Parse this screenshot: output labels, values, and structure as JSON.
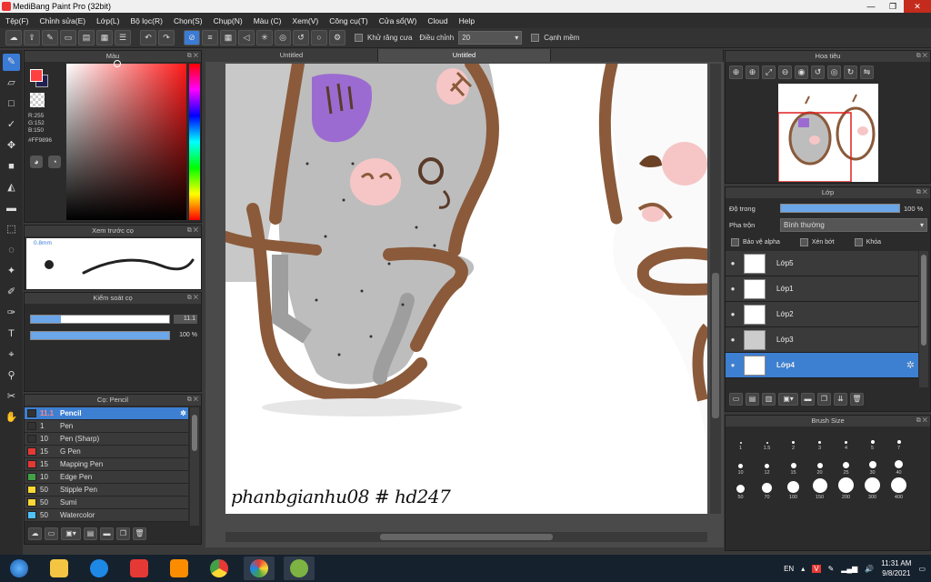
{
  "window": {
    "title": "MediBang Paint Pro (32bit)"
  },
  "menu": [
    "Tệp(F)",
    "Chỉnh sửa(E)",
    "Lớp(L)",
    "Bộ lọc(R)",
    "Chọn(S)",
    "Chụp(N)",
    "Màu (C)",
    "Xem(V)",
    "Công cụ(T)",
    "Cửa sổ(W)",
    "Cloud",
    "Help"
  ],
  "toolbar": {
    "antialias_label": "Khử răng cưa",
    "adjust_label": "Điều chỉnh",
    "adjust_value": "20",
    "edge_label": "Cạnh mềm"
  },
  "tabs": [
    "Untitled",
    "Untitled"
  ],
  "color_panel": {
    "title": "Màu",
    "r": "R:255",
    "g": "G:152",
    "b": "B:150",
    "hex": "#FF9896",
    "primary": "#ff4040",
    "secondary": "#202050"
  },
  "brush_preview": {
    "title": "Xem trước cọ",
    "size": "0.8mm"
  },
  "brush_control": {
    "title": "Kiểm soát cọ",
    "size_value": "11.1",
    "opacity_value": "100 %",
    "size_fraction": 0.22,
    "opacity_fraction": 1.0
  },
  "brush_list": {
    "title": "Cọ: Pencil",
    "items": [
      {
        "size": "11.1",
        "name": "Pencil",
        "color": "#333333"
      },
      {
        "size": "1",
        "name": "Pen",
        "color": "#333333"
      },
      {
        "size": "10",
        "name": "Pen (Sharp)",
        "color": "#333333"
      },
      {
        "size": "15",
        "name": "G Pen",
        "color": "#e53935"
      },
      {
        "size": "15",
        "name": "Mapping Pen",
        "color": "#e53935"
      },
      {
        "size": "10",
        "name": "Edge Pen",
        "color": "#43a047"
      },
      {
        "size": "50",
        "name": "Stipple Pen",
        "color": "#fdd835"
      },
      {
        "size": "50",
        "name": "Sumi",
        "color": "#fdd835"
      },
      {
        "size": "50",
        "name": "Watercolor",
        "color": "#4fc3f7"
      }
    ]
  },
  "navigator": {
    "title": "Hoa tiêu"
  },
  "layer_panel": {
    "title": "Lớp",
    "opacity_label": "Độ trong",
    "opacity_value": "100 %",
    "blend_label": "Pha trộn",
    "blend_value": "Bình thường",
    "protect_alpha": "Bảo vệ alpha",
    "clipping": "Xén bớt",
    "lock": "Khóa",
    "layers": [
      "Lớp5",
      "Lớp1",
      "Lớp2",
      "Lớp3",
      "Lớp4"
    ]
  },
  "brush_size": {
    "title": "Brush Size",
    "sizes": [
      "1",
      "1.5",
      "2",
      "3",
      "4",
      "5",
      "7",
      "10",
      "12",
      "15",
      "20",
      "25",
      "30",
      "40",
      "50",
      "70",
      "100",
      "150",
      "200",
      "300",
      "400"
    ]
  },
  "canvas": {
    "signature": "phanbgianhu08 # hd247"
  },
  "taskbar": {
    "lang": "EN",
    "time": "11:31 AM",
    "date": "9/8/2021"
  }
}
